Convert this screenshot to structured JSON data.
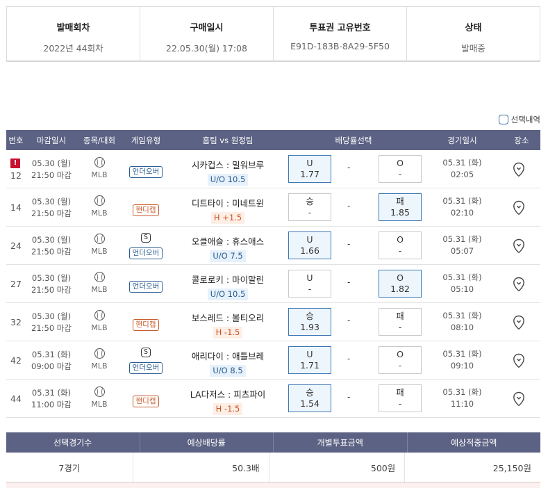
{
  "info": {
    "headers": [
      "발매회차",
      "구매일시",
      "투표권 고유번호",
      "상태"
    ],
    "values": [
      "2022년 44회차",
      "22.05.30(월) 17:08",
      "E91D-183B-8A29-5F50",
      "발매중"
    ]
  },
  "select_detail_label": "선택내역",
  "table": {
    "columns": [
      "번호",
      "마감일시",
      "종목/대회",
      "게임유형",
      "홈팀 vs 원정팀",
      "배당률선택",
      "경기일시",
      "장소"
    ],
    "rows": [
      {
        "no": "12",
        "alert": "!",
        "deadline_date": "05.30 (월)",
        "deadline_time": "21:50 마감",
        "sport": "MLB",
        "s_badge": "",
        "game_type": "언더오버",
        "game_color": "blue",
        "teams": "시카컵스 : 밀워브루",
        "sub": "U/O 10.5",
        "sub_color": "blue",
        "left_sym": "U",
        "left_odd": "1.77",
        "left_sel": true,
        "mid": "-",
        "right_sym": "O",
        "right_odd": "-",
        "right_sel": false,
        "game_date": "05.31 (화)",
        "game_time": "02:05"
      },
      {
        "no": "14",
        "alert": "",
        "deadline_date": "05.30 (월)",
        "deadline_time": "21:50 마감",
        "sport": "MLB",
        "s_badge": "",
        "game_type": "핸디캡",
        "game_color": "orange",
        "teams": "디트타이 : 미네트윈",
        "sub": "H +1.5",
        "sub_color": "orange",
        "left_sym": "승",
        "left_odd": "-",
        "left_sel": false,
        "mid": "-",
        "right_sym": "패",
        "right_odd": "1.85",
        "right_sel": true,
        "game_date": "05.31 (화)",
        "game_time": "02:10"
      },
      {
        "no": "24",
        "alert": "",
        "deadline_date": "05.30 (월)",
        "deadline_time": "21:50 마감",
        "sport": "MLB",
        "s_badge": "S",
        "game_type": "언더오버",
        "game_color": "blue",
        "teams": "오클애슬 : 휴스애스",
        "sub": "U/O 7.5",
        "sub_color": "blue",
        "left_sym": "U",
        "left_odd": "1.66",
        "left_sel": true,
        "mid": "-",
        "right_sym": "O",
        "right_odd": "-",
        "right_sel": false,
        "game_date": "05.31 (화)",
        "game_time": "05:07"
      },
      {
        "no": "27",
        "alert": "",
        "deadline_date": "05.30 (월)",
        "deadline_time": "21:50 마감",
        "sport": "MLB",
        "s_badge": "",
        "game_type": "언더오버",
        "game_color": "blue",
        "teams": "콜로로키 : 마이말린",
        "sub": "U/O 10.5",
        "sub_color": "blue",
        "left_sym": "U",
        "left_odd": "-",
        "left_sel": false,
        "mid": "-",
        "right_sym": "O",
        "right_odd": "1.82",
        "right_sel": true,
        "game_date": "05.31 (화)",
        "game_time": "05:10"
      },
      {
        "no": "32",
        "alert": "",
        "deadline_date": "05.30 (월)",
        "deadline_time": "21:50 마감",
        "sport": "MLB",
        "s_badge": "",
        "game_type": "핸디캡",
        "game_color": "orange",
        "teams": "보스레드 : 볼티오리",
        "sub": "H -1.5",
        "sub_color": "orange",
        "left_sym": "승",
        "left_odd": "1.93",
        "left_sel": true,
        "mid": "-",
        "right_sym": "패",
        "right_odd": "-",
        "right_sel": false,
        "game_date": "05.31 (화)",
        "game_time": "08:10"
      },
      {
        "no": "42",
        "alert": "",
        "deadline_date": "05.31 (화)",
        "deadline_time": "09:00 마감",
        "sport": "MLB",
        "s_badge": "S",
        "game_type": "언더오버",
        "game_color": "blue",
        "teams": "애리다이 : 애틀브레",
        "sub": "U/O 8.5",
        "sub_color": "blue",
        "left_sym": "U",
        "left_odd": "1.71",
        "left_sel": true,
        "mid": "-",
        "right_sym": "O",
        "right_odd": "-",
        "right_sel": false,
        "game_date": "05.31 (화)",
        "game_time": "09:10"
      },
      {
        "no": "44",
        "alert": "",
        "deadline_date": "05.31 (화)",
        "deadline_time": "11:00 마감",
        "sport": "MLB",
        "s_badge": "",
        "game_type": "핸디캡",
        "game_color": "orange",
        "teams": "LA다저스 : 피츠파이",
        "sub": "H -1.5",
        "sub_color": "orange",
        "left_sym": "승",
        "left_odd": "1.54",
        "left_sel": true,
        "mid": "-",
        "right_sym": "패",
        "right_odd": "-",
        "right_sel": false,
        "game_date": "05.31 (화)",
        "game_time": "11:10"
      }
    ]
  },
  "summary": {
    "headers": [
      "선택경기수",
      "예상배당률",
      "개별투표금액",
      "예상적중금액"
    ],
    "values": [
      "7경기",
      "50.3배",
      "500원",
      "25,150원"
    ]
  },
  "colors": {
    "header_bg": "#5b6283",
    "selected_border": "#3b77b4",
    "selected_bg": "#eef6fd",
    "alert_red": "#c8102e",
    "handicap_orange": "#c95a2a",
    "underover_blue": "#2d5e93"
  },
  "icons": {
    "sport": "baseball-icon",
    "location": "location-pin-icon",
    "alert": "alert-icon"
  }
}
